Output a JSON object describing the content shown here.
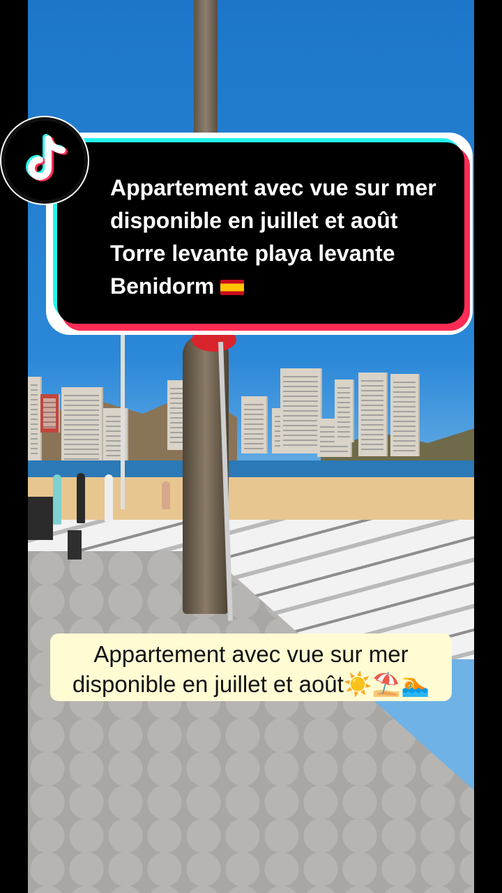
{
  "overlay": {
    "title_card": {
      "text": "Appartement avec vue sur mer disponible en juillet et août Torre levante playa levante Benidorm",
      "flag_icon": "spain-flag-icon"
    },
    "caption": {
      "text": "Appartement avec vue sur mer disponible en juillet et août",
      "emojis": "☀️⛱️🏊"
    }
  },
  "branding": {
    "logo": "tiktok-logo-icon",
    "colors": {
      "cyan": "#25f4ee",
      "red": "#fe2c55",
      "caption_bg": "#fffbd3"
    }
  }
}
